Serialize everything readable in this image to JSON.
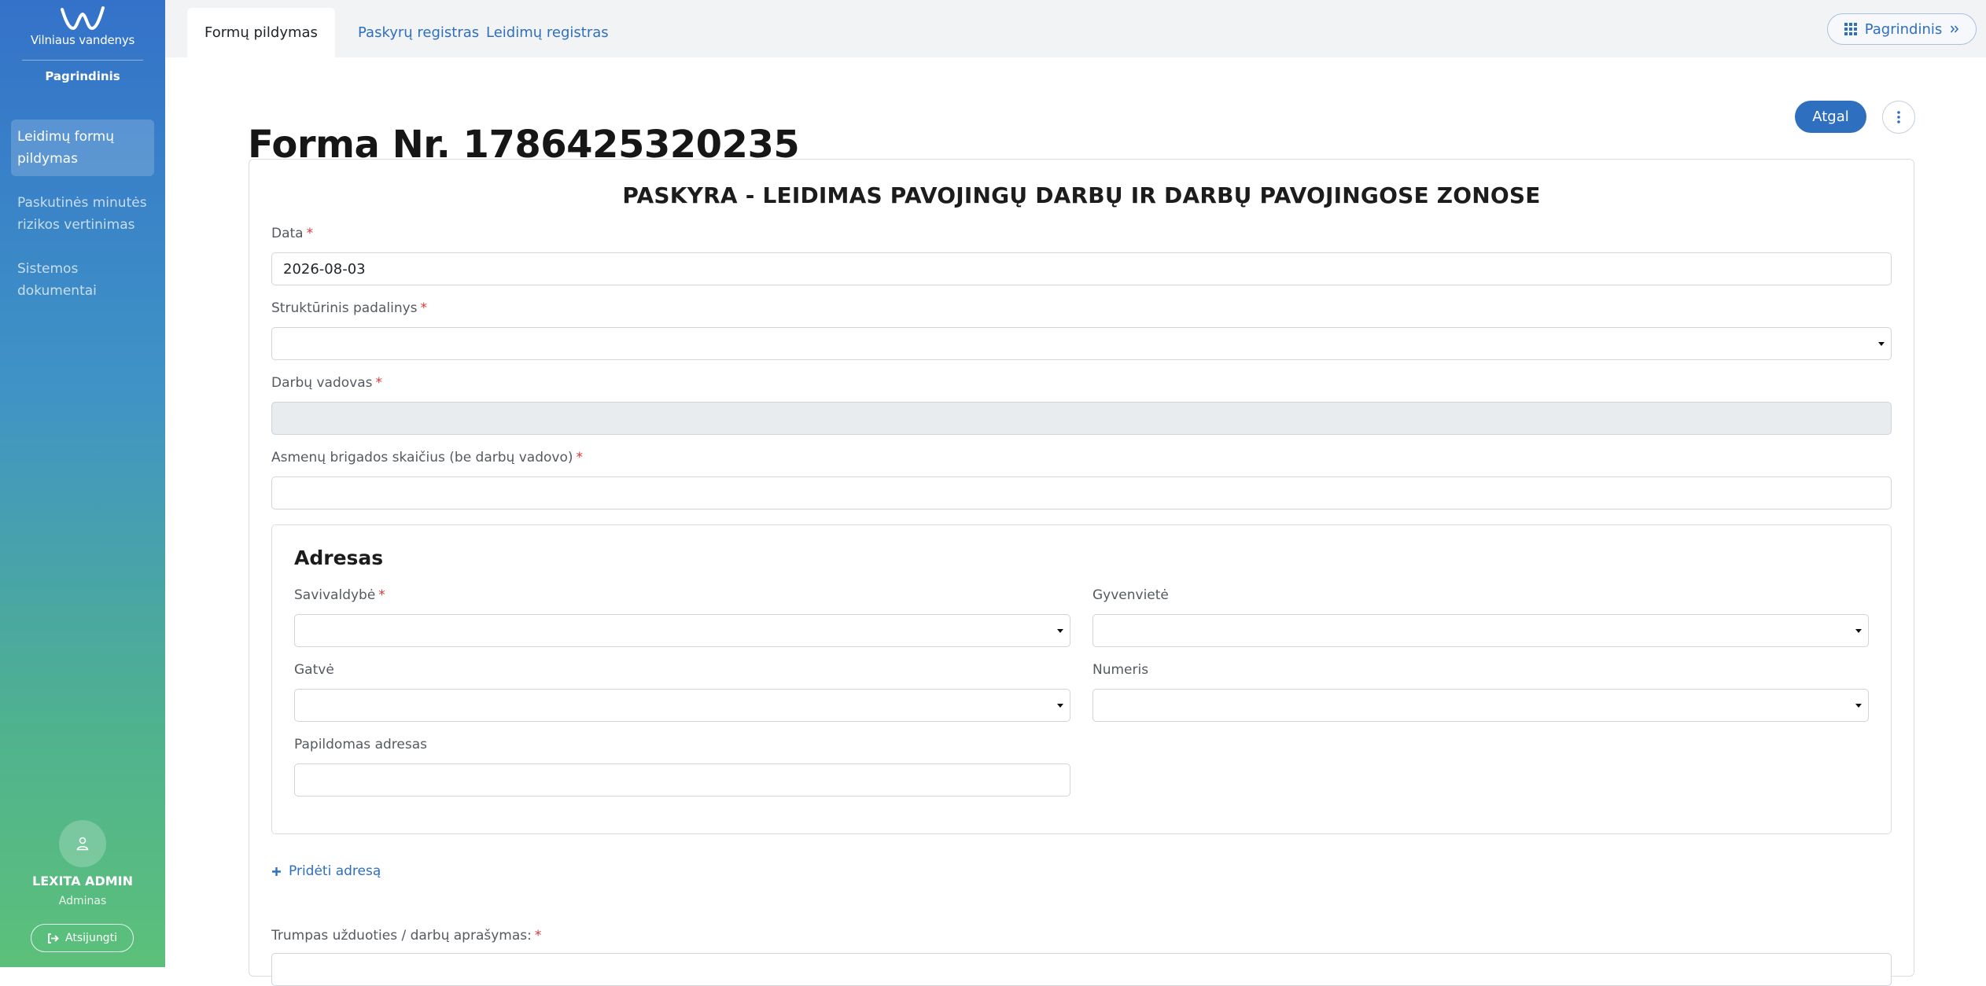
{
  "sidebar": {
    "brand_name": "Vilniaus vandenys",
    "brand_sub": "Pagrindinis",
    "items": [
      {
        "label_line1": "Leidimų formų",
        "label_line2": "pildymas"
      },
      {
        "label_line1": "Paskutinės minutės",
        "label_line2": "rizikos vertinimas"
      },
      {
        "label_line1": "Sistemos",
        "label_line2": "dokumentai"
      }
    ],
    "user": {
      "name": "LEXITA ADMIN",
      "role": "Adminas"
    },
    "logout_label": "Atsijungti"
  },
  "topbar": {
    "tabs": [
      {
        "label": "Formų pildymas"
      },
      {
        "label": "Paskyrų registras"
      },
      {
        "label": "Leidimų registras"
      }
    ],
    "home_button_label": "Pagrindinis"
  },
  "page": {
    "title": "Forma Nr. 1786425320235",
    "back_label": "Atgal"
  },
  "form": {
    "heading": "PASKYRA - LEIDIMAS PAVOJINGŲ DARBŲ IR DARBŲ PAVOJINGOSE ZONOSE",
    "date_label": "Data",
    "date_value": "2026-08-03",
    "unit_label": "Struktūrinis padalinys",
    "manager_label": "Darbų vadovas",
    "brigade_label": "Asmenų brigados skaičius (be darbų vadovo)",
    "address": {
      "title": "Adresas",
      "municipality_label": "Savivaldybė",
      "settlement_label": "Gyvenvietė",
      "street_label": "Gatvė",
      "number_label": "Numeris",
      "extra_label": "Papildomas adresas"
    },
    "add_address_label": "Pridėti adresą",
    "description_label": "Trumpas užduoties / darbų aprašymas:"
  },
  "colors": {
    "accent": "#2f6fc0",
    "required": "#d9363e",
    "sidebar_top": "#3472c9",
    "sidebar_bottom": "#5cc07a"
  }
}
